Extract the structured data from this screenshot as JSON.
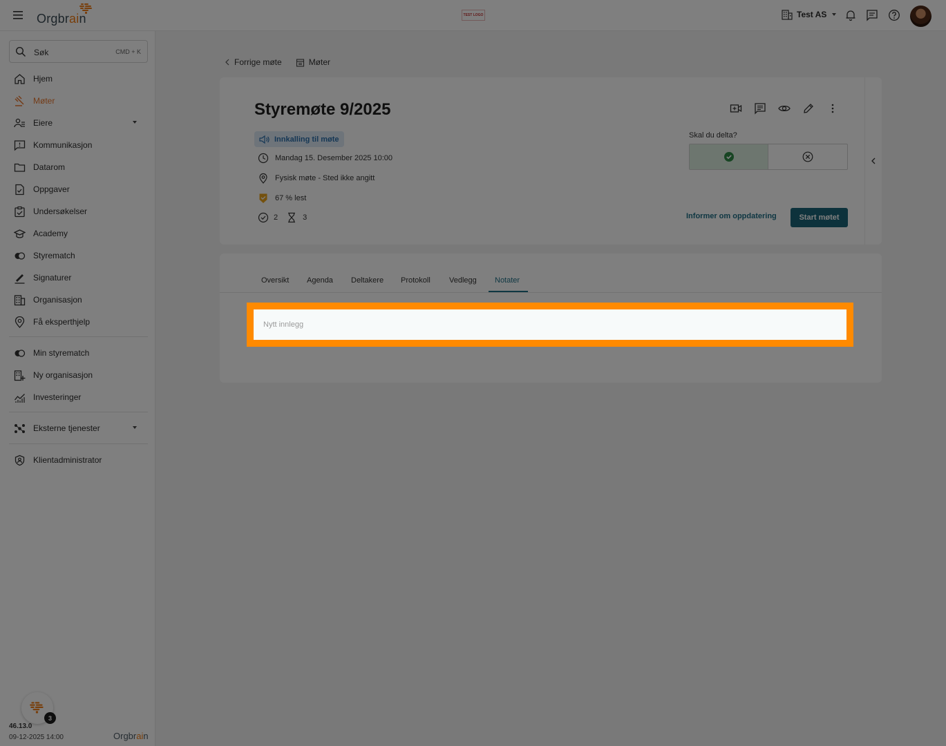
{
  "app": {
    "brand": "Orgbrain",
    "test_logo": "TEST LOGO"
  },
  "header": {
    "org_name": "Test AS"
  },
  "search": {
    "label": "Søk",
    "shortcut": "CMD + K"
  },
  "sidebar": {
    "items": [
      {
        "label": "Hjem",
        "icon": "home-icon"
      },
      {
        "label": "Møter",
        "icon": "gavel-icon",
        "active": true
      },
      {
        "label": "Eiere",
        "icon": "owners-icon"
      },
      {
        "label": "Kommunikasjon",
        "icon": "message-icon"
      },
      {
        "label": "Datarom",
        "icon": "folder-icon"
      },
      {
        "label": "Oppgaver",
        "icon": "tasks-icon"
      },
      {
        "label": "Undersøkelser",
        "icon": "survey-icon"
      },
      {
        "label": "Academy",
        "icon": "academy-icon"
      },
      {
        "label": "Styrematch",
        "icon": "match-icon"
      },
      {
        "label": "Signaturer",
        "icon": "signature-icon"
      },
      {
        "label": "Organisasjon",
        "icon": "building-icon"
      },
      {
        "label": "Få eksperthjelp",
        "icon": "expert-icon"
      }
    ],
    "secondary": [
      {
        "label": "Min styrematch",
        "icon": "match-icon"
      },
      {
        "label": "Ny organisasjon",
        "icon": "new-building-icon"
      },
      {
        "label": "Investeringer",
        "icon": "investments-icon"
      }
    ],
    "external": {
      "label": "Eksterne tjenester",
      "icon": "external-icon"
    },
    "admin": {
      "label": "Klientadministrator",
      "icon": "admin-shield-icon"
    },
    "version": "46.13.0",
    "version_date": "09-12-2025 14:00",
    "help_badge": "3"
  },
  "breadcrumb": {
    "back": "Forrige møte",
    "section": "Møter"
  },
  "meeting": {
    "title": "Styremøte 9/2025",
    "status_chip": "Innkalling til møte",
    "datetime": "Mandag 15. Desember 2025 10:00",
    "location": "Fysisk møte - Sted ikke angitt",
    "read_status": "67 % lest",
    "accepted_count": "2",
    "pending_count": "3",
    "attend_question": "Skal du delta?",
    "inform_label": "Informer om oppdatering",
    "start_label": "Start møtet"
  },
  "tabs": [
    {
      "label": "Oversikt"
    },
    {
      "label": "Agenda"
    },
    {
      "label": "Deltakere"
    },
    {
      "label": "Protokoll"
    },
    {
      "label": "Vedlegg"
    },
    {
      "label": "Notater",
      "active": true
    }
  ],
  "notes": {
    "placeholder": "Nytt innlegg"
  },
  "colors": {
    "accent": "#1f6f86",
    "active_nav": "#e8772e",
    "highlight": "#ff8a00",
    "start_button": "#1a6578"
  }
}
